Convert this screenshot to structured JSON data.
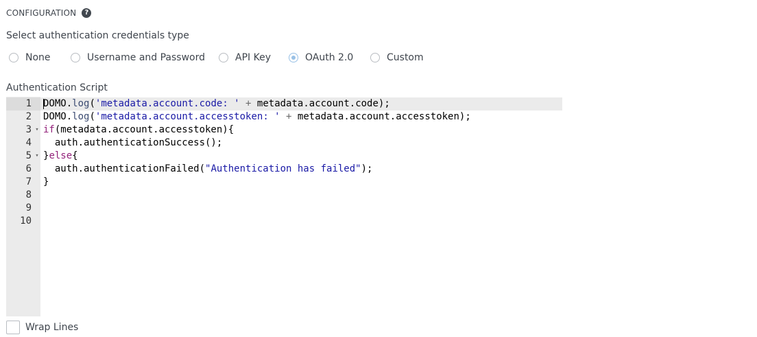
{
  "config": {
    "title": "CONFIGURATION",
    "help_icon": "question-circle-icon"
  },
  "auth_type": {
    "label": "Select authentication credentials type",
    "options": [
      {
        "label": "None",
        "selected": false
      },
      {
        "label": "Username and Password",
        "selected": false
      },
      {
        "label": "API Key",
        "selected": false
      },
      {
        "label": "OAuth 2.0",
        "selected": true
      },
      {
        "label": "Custom",
        "selected": false
      }
    ],
    "accent_color": "#99c1e6"
  },
  "script": {
    "label": "Authentication Script",
    "line_numbers": [
      "1",
      "2",
      "3",
      "4",
      "5",
      "6",
      "7",
      "8",
      "9",
      "10"
    ],
    "fold_markers": [
      "",
      "",
      "▾",
      "",
      "▾",
      "",
      "",
      "",
      "",
      ""
    ],
    "lines": [
      "DOMO.log('metadata.account.code: ' + metadata.account.code);",
      "DOMO.log('metadata.account.accesstoken: ' + metadata.account.accesstoken);",
      "if(metadata.account.accesstoken){",
      "  auth.authenticationSuccess();",
      "}else{",
      "  auth.authenticationFailed(\"Authentication has failed\");",
      "}",
      "",
      "",
      ""
    ],
    "active_line": 1
  },
  "wrap_lines": {
    "label": "Wrap Lines",
    "checked": false
  }
}
